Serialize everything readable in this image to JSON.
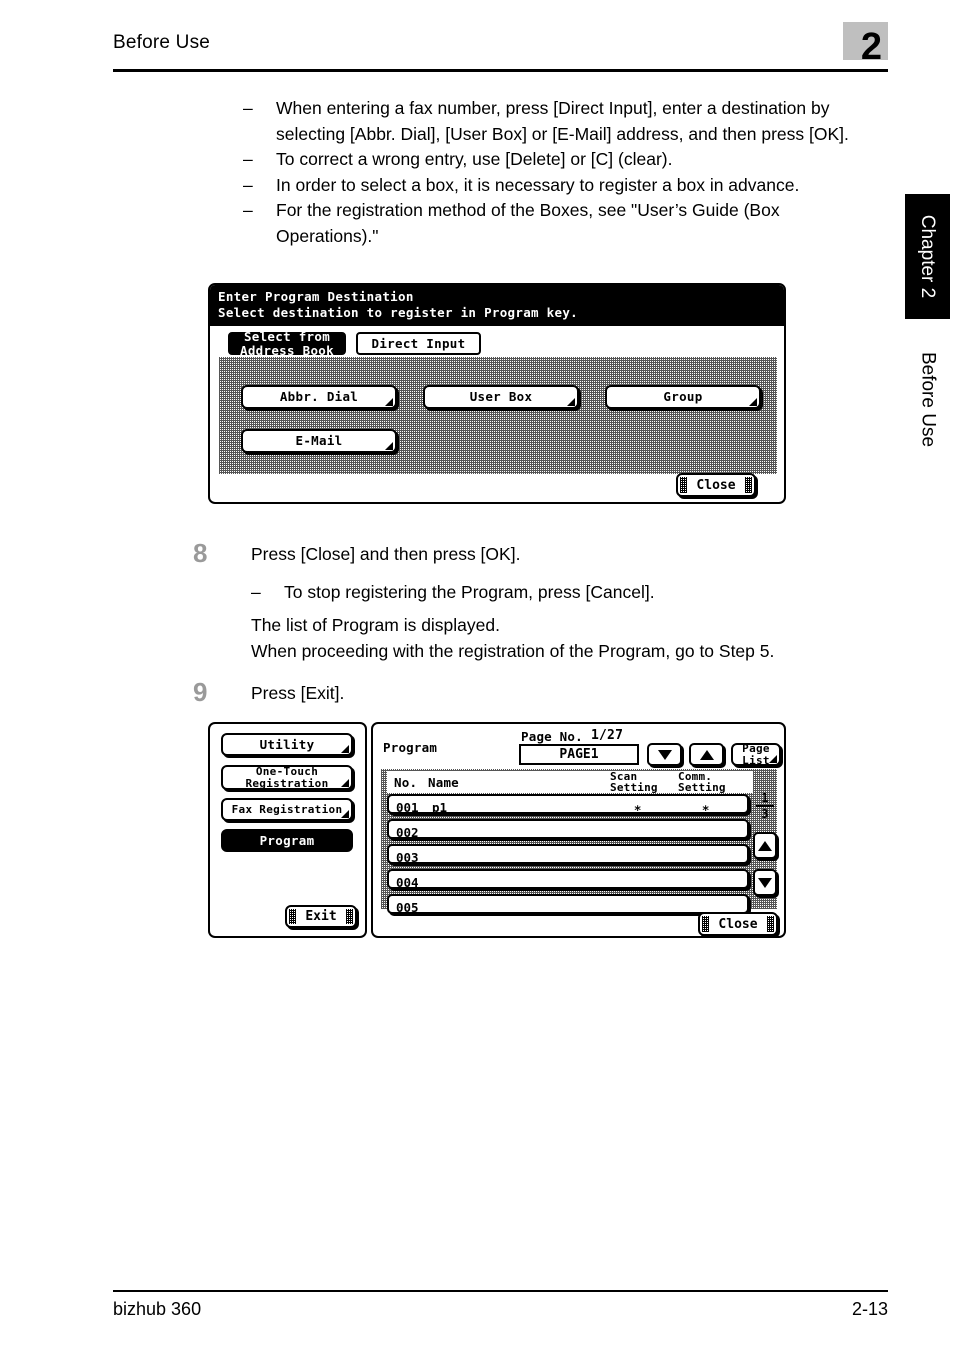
{
  "header": {
    "title": "Before Use",
    "chapter_number": "2"
  },
  "side": {
    "tab_label": "Chapter 2",
    "section_label": "Before Use"
  },
  "footer": {
    "model": "bizhub 360",
    "page_number": "2-13"
  },
  "notes": {
    "dash": "–",
    "items": [
      "When entering a fax number, press [Direct Input], enter a destination by selecting [Abbr. Dial], [User Box] or [E-Mail] address, and then press [OK].",
      "To correct a wrong entry, use [Delete] or [C] (clear).",
      "In order to select a box, it is necessary to register a box in advance.",
      "For the registration method of the Boxes, see \"User’s Guide (Box Operations).\""
    ]
  },
  "steps": [
    {
      "number": "8",
      "main": "Press [Close] and then press [OK].",
      "sub": "To stop registering the Program, press [Cancel].",
      "lines": [
        "The list of Program is displayed.",
        "When proceeding with the registration of the Program, go to Step 5."
      ]
    },
    {
      "number": "9",
      "main": "Press [Exit]."
    }
  ],
  "lcd_destination": {
    "title_line1": "Enter Program Destination",
    "title_line2": "Select destination to register in Program key.",
    "tabs": [
      {
        "label": "Select from\nAddress Book",
        "selected": true
      },
      {
        "label": "Direct Input",
        "selected": false
      }
    ],
    "buttons": [
      {
        "label": "Abbr. Dial"
      },
      {
        "label": "User Box"
      },
      {
        "label": "Group"
      },
      {
        "label": "E-Mail"
      }
    ],
    "close_label": "Close"
  },
  "lcd_program": {
    "menu": [
      {
        "label": "Utility",
        "selected": false
      },
      {
        "label": "One-Touch\nRegistration",
        "selected": false
      },
      {
        "label": "Fax Registration",
        "selected": false
      },
      {
        "label": "Program",
        "selected": true
      }
    ],
    "exit_label": "Exit",
    "panel_title": "Program",
    "page_no_label": "Page No.",
    "page_no_value": "1/27",
    "page_field_value": "PAGE1",
    "page_list_label": "Page\nList",
    "columns": {
      "no": "No.",
      "name": "Name",
      "scan_setting": "Scan\nSetting",
      "comm_setting": "Comm.\nSetting"
    },
    "rows": [
      {
        "no": "001",
        "name": "p1",
        "scan": "∗",
        "comm": "∗"
      },
      {
        "no": "002",
        "name": "",
        "scan": "",
        "comm": ""
      },
      {
        "no": "003",
        "name": "",
        "scan": "",
        "comm": ""
      },
      {
        "no": "004",
        "name": "",
        "scan": "",
        "comm": ""
      },
      {
        "no": "005",
        "name": "",
        "scan": "",
        "comm": ""
      }
    ],
    "scroll_indicator": {
      "numerator": "1",
      "denominator": "3"
    },
    "close_label": "Close"
  }
}
